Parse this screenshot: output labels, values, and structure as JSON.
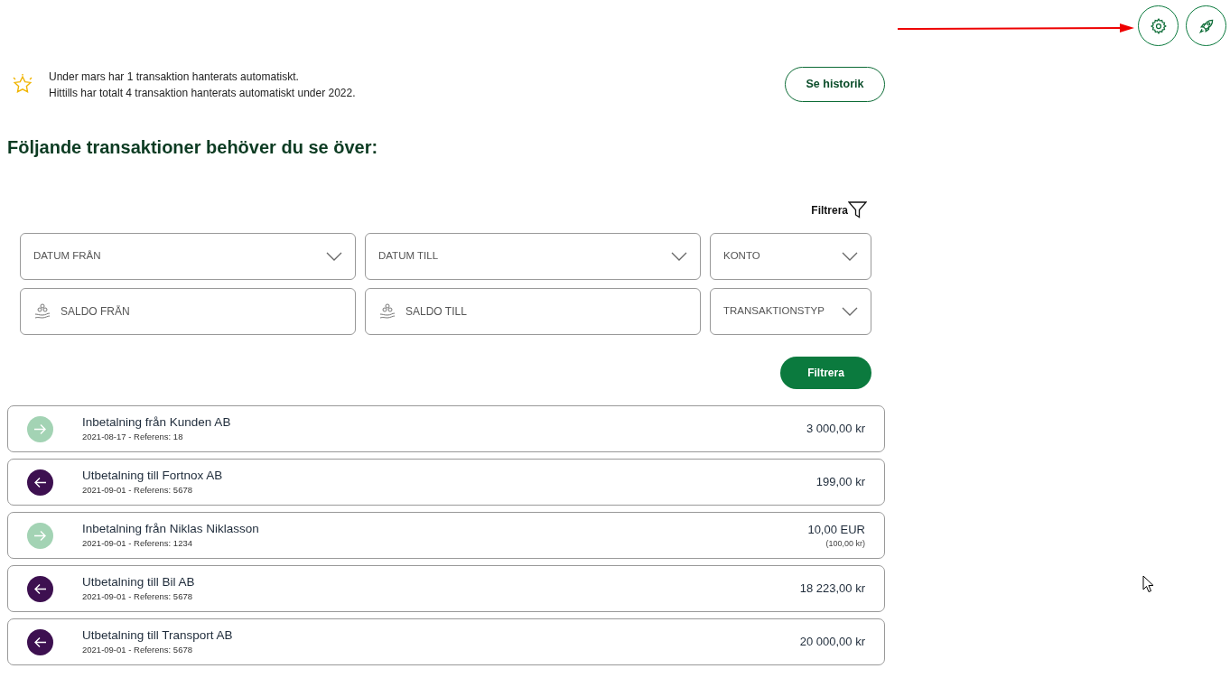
{
  "summary": {
    "lines": [
      "Under mars har 1 transaktion hanterats automatiskt.",
      "Hittills har totalt 4 transaktion hanterats automatiskt under 2022."
    ],
    "history_button": "Se historik"
  },
  "heading": "Följande transaktioner behöver du se över:",
  "filter_toggle": "Filtrera",
  "filters": [
    {
      "kind": "select",
      "placeholder": "DATUM FRÅN"
    },
    {
      "kind": "select",
      "placeholder": "DATUM TILL"
    },
    {
      "kind": "select",
      "placeholder": "KONTO"
    },
    {
      "kind": "amount",
      "placeholder": "SALDO FRÅN"
    },
    {
      "kind": "amount",
      "placeholder": "SALDO TILL"
    },
    {
      "kind": "select",
      "placeholder": "TRANSAKTIONSTYP"
    }
  ],
  "filter_button": "Filtrera",
  "transactions": [
    {
      "kind": "incoming",
      "title": "Inbetalning från Kunden AB",
      "details": "2021-08-17 - Referens: 18",
      "amount": "3 000,00 kr"
    },
    {
      "kind": "outgoing",
      "title": "Utbetalning till Fortnox AB",
      "details": "2021-09-01 - Referens: 5678",
      "amount": "199,00 kr"
    },
    {
      "kind": "incoming",
      "title": "Inbetalning från Niklas Niklasson",
      "details": "2021-09-01 - Referens: 1234",
      "amount": "10,00 EUR",
      "converted": "(100,00 kr)"
    },
    {
      "kind": "outgoing",
      "title": "Utbetalning till Bil AB",
      "details": "2021-09-01 - Referens: 5678",
      "amount": "18 223,00 kr"
    },
    {
      "kind": "outgoing",
      "title": "Utbetalning till Transport AB",
      "details": "2021-09-01 - Referens: 5678",
      "amount": "20 000,00 kr"
    }
  ]
}
